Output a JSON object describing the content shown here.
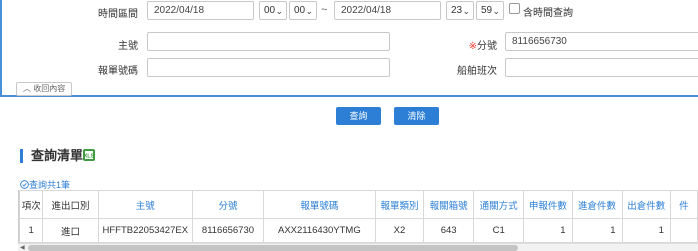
{
  "filter": {
    "time_range_label": "時間區間",
    "start_date": "2022/04/18",
    "start_hour": "00",
    "start_min": "00",
    "tilde": "~",
    "end_date": "2022/04/18",
    "end_hour": "23",
    "end_min": "59",
    "include_time_label": "含時間查詢",
    "master_no_label": "主號",
    "master_no_value": "",
    "house_no_required_mark": "※",
    "house_no_label": "分號",
    "house_no_value": "8116656730",
    "declaration_no_label": "報單號碼",
    "declaration_no_value": "",
    "voyage_label": "船舶班次",
    "voyage_value": "",
    "collapse_label": "收回內容",
    "collapse_glyph": "︿"
  },
  "actions": {
    "search_label": "查詢",
    "clear_label": "清除"
  },
  "results": {
    "title": "查詢清單",
    "count_text": "查詢共1筆",
    "count_icon": "circle-check-icon",
    "export_icon": "excel-icon",
    "columns": [
      "項次",
      "進出口別",
      "主號",
      "分號",
      "報單號碼",
      "報單類別",
      "報關箱號",
      "通關方式",
      "申報件數",
      "進倉件數",
      "出倉件數",
      "件"
    ],
    "rows": [
      [
        "1",
        "進口",
        "HFFTB22053427EX",
        "8116656730",
        "AXX2116430YTMG",
        "X2",
        "643",
        "C1",
        "1",
        "1",
        "1",
        ""
      ]
    ]
  },
  "colors": {
    "accent": "#2d7fd6",
    "required": "#e53935",
    "panel_border": "#4a90d9"
  }
}
